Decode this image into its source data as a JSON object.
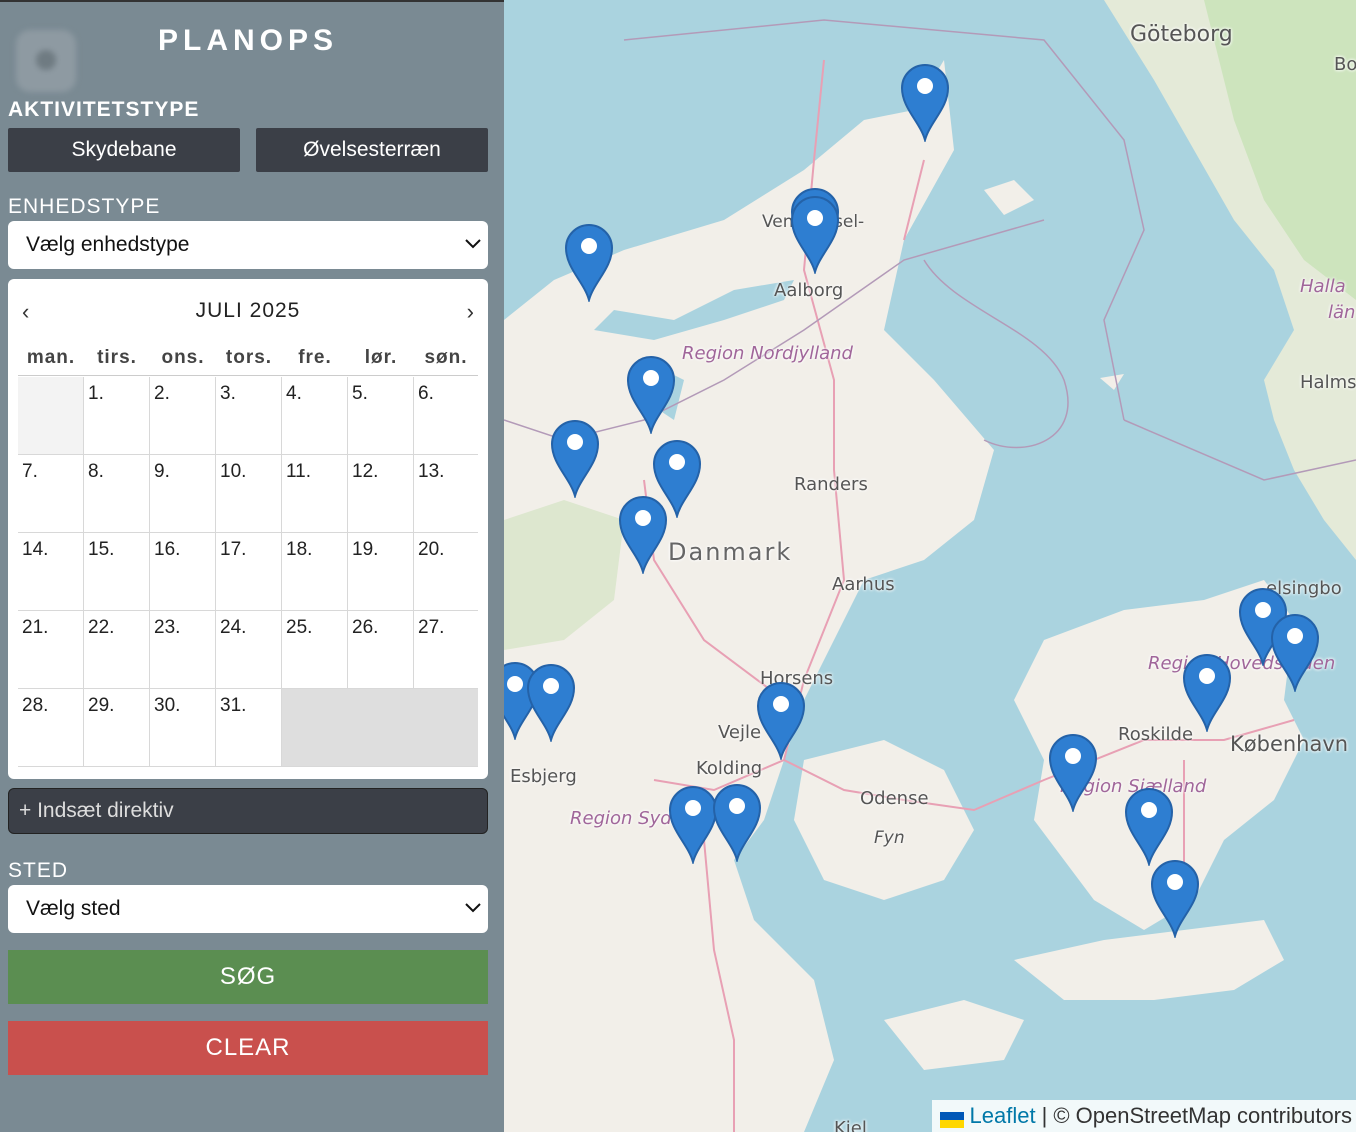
{
  "app": {
    "title": "PLANOPS"
  },
  "activity": {
    "label": "AKTIVITETSTYPE",
    "buttons": [
      "Skydebane",
      "Øvelsesterræn"
    ]
  },
  "unit": {
    "label": "ENHEDSTYPE",
    "placeholder": "Vælg enhedstype"
  },
  "calendar": {
    "month": "JULI 2025",
    "prev": "‹",
    "next": "›",
    "weekdays": [
      "man.",
      "tirs.",
      "ons.",
      "tors.",
      "fre.",
      "lør.",
      "søn."
    ],
    "days": [
      "1.",
      "2.",
      "3.",
      "4.",
      "5.",
      "6.",
      "7.",
      "8.",
      "9.",
      "10.",
      "11.",
      "12.",
      "13.",
      "14.",
      "15.",
      "16.",
      "17.",
      "18.",
      "19.",
      "20.",
      "21.",
      "22.",
      "23.",
      "24.",
      "25.",
      "26.",
      "27.",
      "28.",
      "29.",
      "30.",
      "31."
    ]
  },
  "directive": {
    "label": "+ Indsæt direktiv"
  },
  "place": {
    "label": "STED",
    "placeholder": "Vælg sted"
  },
  "actions": {
    "search": "SØG",
    "clear": "CLEAR",
    "search_color": "#5b8e51",
    "clear_color": "#c9504d"
  },
  "map": {
    "labels": {
      "goteborg": "Göteborg",
      "bo": "Bo",
      "vendsyssel": "Ven",
      "vendsyssel2": "sel-",
      "aalborg": "Aalborg",
      "region_nordjylland": "Region Nordjylland",
      "halland": "Halla",
      "halland2": "län",
      "halmstad": "Halms",
      "randers": "Randers",
      "danmark": "Danmark",
      "aarhus": "Aarhus",
      "helsingborg": "elsingbo",
      "horsens": "Horsens",
      "region_hovedstaden": "Region Hovedstaden",
      "vejle": "Vejle",
      "roskilde": "Roskilde",
      "kobenhavn": "København",
      "kolding": "Kolding",
      "esbjerg": "Esbjerg",
      "odense": "Odense",
      "region_sjaelland": "Region Sjælland",
      "region_syd": "Region Syddanmark",
      "fyn": "Fyn",
      "kiel": "Kiel"
    },
    "attribution": {
      "leaflet": "Leaflet",
      "separator": "|",
      "osm": "© OpenStreetMap contributors"
    }
  }
}
